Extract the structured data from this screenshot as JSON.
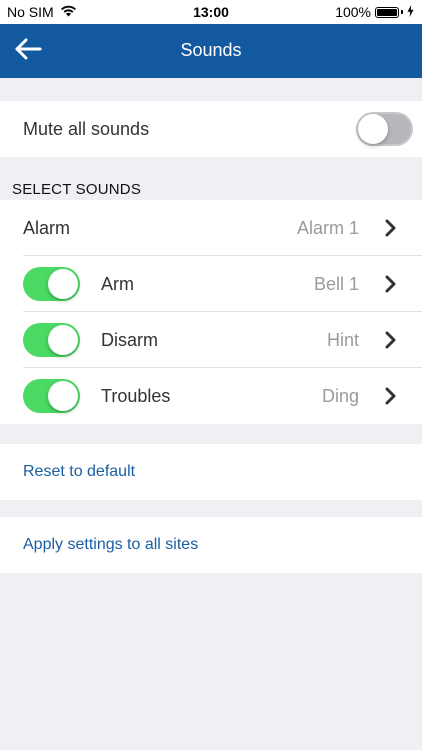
{
  "status_bar": {
    "carrier": "No SIM",
    "time": "13:00",
    "battery": "100%",
    "battery_level": 1.0
  },
  "nav": {
    "title": "Sounds",
    "back_icon": "arrow-left-icon"
  },
  "mute": {
    "label": "Mute all sounds",
    "enabled": false
  },
  "select_sounds": {
    "header": "SELECT SOUNDS",
    "items": [
      {
        "label": "Alarm",
        "value": "Alarm 1",
        "has_toggle": false
      },
      {
        "label": "Arm",
        "value": "Bell 1",
        "has_toggle": true,
        "enabled": true
      },
      {
        "label": "Disarm",
        "value": "Hint",
        "has_toggle": true,
        "enabled": true
      },
      {
        "label": "Troubles",
        "value": "Ding",
        "has_toggle": true,
        "enabled": true
      }
    ]
  },
  "actions": {
    "reset": "Reset to default",
    "apply": "Apply settings to all sites"
  },
  "colors": {
    "nav_bg": "#1259a0",
    "toggle_on": "#4cd964",
    "link": "#1b5fa3",
    "background": "#efeff4"
  }
}
